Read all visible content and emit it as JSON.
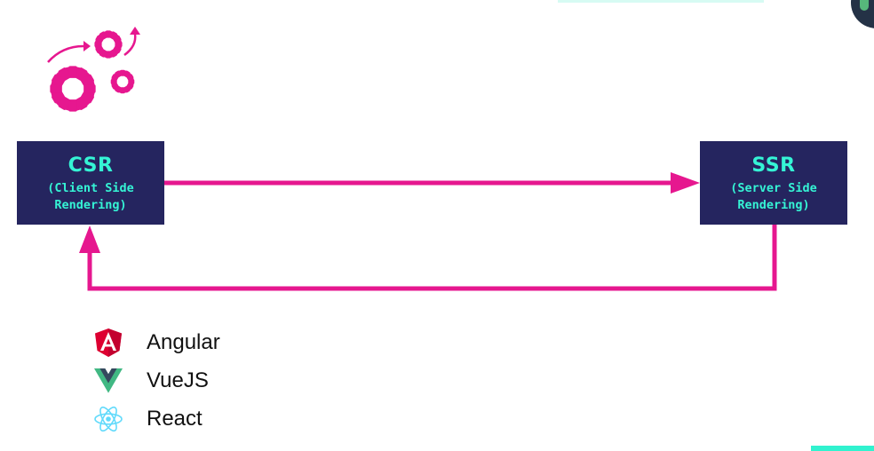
{
  "nodes": {
    "csr": {
      "title": "CSR",
      "line1": "(Client Side",
      "line2": "Rendering)"
    },
    "ssr": {
      "title": "SSR",
      "line1": "(Server Side",
      "line2": "Rendering)"
    }
  },
  "frameworks": [
    {
      "label": "Angular",
      "icon": "angular-icon"
    },
    {
      "label": "VueJS",
      "icon": "vue-icon"
    },
    {
      "label": "React",
      "icon": "react-icon"
    }
  ],
  "decor": {
    "icon": "gears-icon"
  },
  "colors": {
    "node_bg": "#25255F",
    "node_text": "#35F4D5",
    "arrow": "#E6178F",
    "accent_strip": "#31F2CF"
  }
}
